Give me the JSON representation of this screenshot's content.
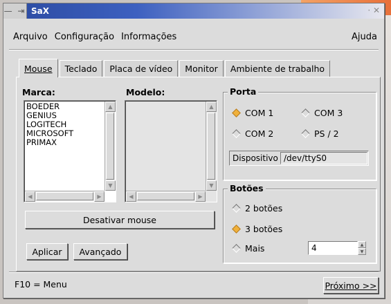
{
  "window": {
    "title": "SaX",
    "controls": "— ⇥",
    "close_glyph": "·  ✕"
  },
  "menu": {
    "file": "Arquivo",
    "config": "Configuração",
    "info": "Informações",
    "help": "Ajuda"
  },
  "tabs": [
    {
      "label": "Mouse",
      "active": true
    },
    {
      "label": "Teclado",
      "active": false
    },
    {
      "label": "Placa de vídeo",
      "active": false
    },
    {
      "label": "Monitor",
      "active": false
    },
    {
      "label": "Ambiente de trabalho",
      "active": false
    }
  ],
  "mouse": {
    "brand_label": "Marca:",
    "model_label": "Modelo:",
    "brands": [
      "BOEDER",
      "GENIUS",
      "LOGITECH",
      "MICROSOFT",
      "PRIMAX"
    ],
    "models": [],
    "disable_button": "Desativar mouse",
    "apply_button": "Aplicar",
    "advanced_button": "Avançado"
  },
  "port": {
    "title": "Porta",
    "options": [
      {
        "label": "COM 1",
        "selected": true
      },
      {
        "label": "COM 3",
        "selected": false
      },
      {
        "label": "COM 2",
        "selected": false
      },
      {
        "label": "PS / 2",
        "selected": false
      }
    ],
    "device_label": "Dispositivo",
    "device_value": "/dev/ttyS0"
  },
  "buttons": {
    "title": "Botões",
    "options": [
      {
        "label": "2 botões",
        "selected": false
      },
      {
        "label": "3 botões",
        "selected": true
      },
      {
        "label": "Mais",
        "selected": false
      }
    ],
    "more_value": "4"
  },
  "footer": {
    "hint": "F10 = Menu",
    "next_button": "Próximo >>"
  },
  "colors": {
    "selected_radio": "#f0b13b",
    "titlebar": "#2b4aa0"
  }
}
